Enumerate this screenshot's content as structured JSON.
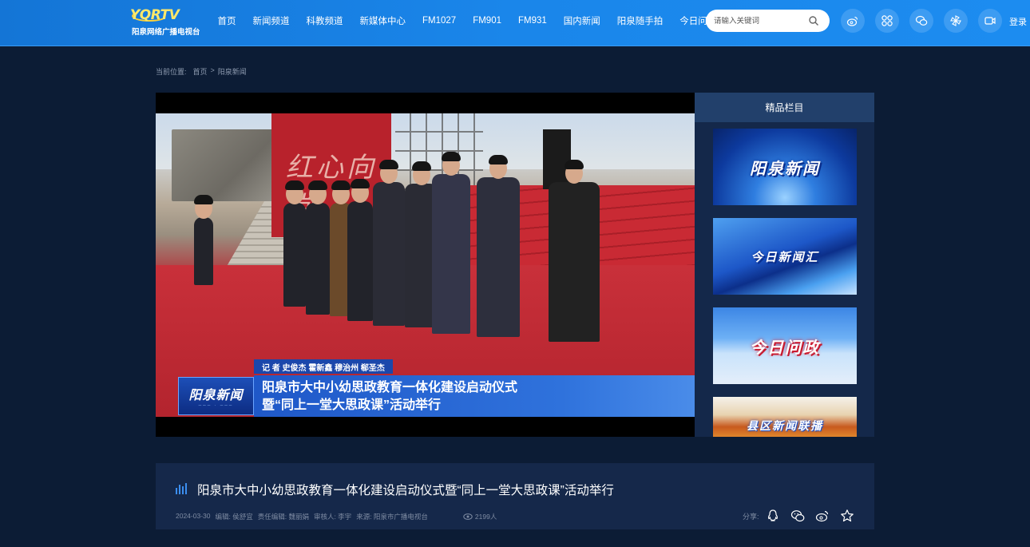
{
  "header": {
    "logo_text": "YQRTV",
    "logo_sub": "阳泉网络广播电视台",
    "nav": [
      "首页",
      "新闻频道",
      "科教频道",
      "新媒体中心",
      "FM1027",
      "FM901",
      "FM931",
      "国内新闻",
      "阳泉随手拍",
      "今日问政"
    ],
    "search_placeholder": "请输入关键词",
    "login": "登录",
    "icons": [
      "weibo-icon",
      "apps-icon",
      "wechat-icon",
      "pinwheel-icon",
      "video-icon"
    ]
  },
  "breadcrumb": {
    "label": "当前位置:",
    "items": [
      "首页",
      "阳泉新闻"
    ],
    "separator": ">"
  },
  "video": {
    "reporter_line": "记 者   史俊杰   霍新鑫   穆治州   郗圣杰",
    "caption_line1": "阳泉市大中小幼思政教育一体化建设启动仪式",
    "caption_line2": "暨“同上一堂大思政课”活动举行",
    "program_logo": "阳泉新闻",
    "wall_text": "红心向党"
  },
  "sidebar": {
    "title": "精品栏目",
    "programs": [
      "阳泉新闻",
      "今日新闻汇",
      "今日问政",
      "县区新闻联播"
    ]
  },
  "article": {
    "title": "阳泉市大中小幼思政教育一体化建设启动仪式暨“同上一堂大思政课”活动举行",
    "date": "2024-03-30",
    "editor": "编辑: 侯舒宜",
    "chief_editor": "责任编辑: 魏丽娟",
    "reviewer": "审核人: 李宇",
    "source": "来源: 阳泉市广播电视台",
    "views": "2199人",
    "share_label": "分享:"
  },
  "colors": {
    "header_blue": "#1a86ea",
    "page_bg": "#0c1c35",
    "panel_bg": "#15284a"
  }
}
